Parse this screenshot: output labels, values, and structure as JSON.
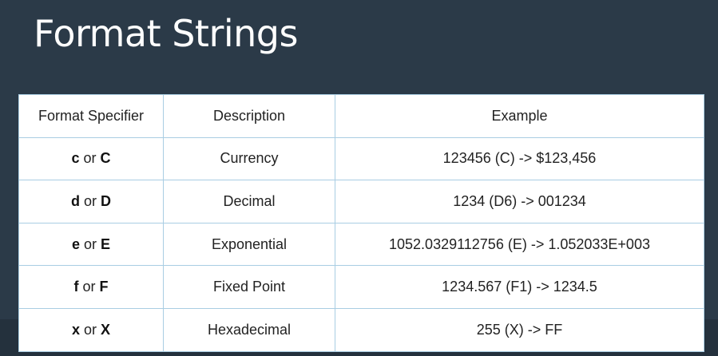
{
  "slide": {
    "title": "Format Strings"
  },
  "table": {
    "headers": [
      "Format Specifier",
      "Description",
      "Example"
    ],
    "rows": [
      {
        "lower": "c",
        "joiner": "or",
        "upper": "C",
        "description": "Currency",
        "example": "123456 (C) -> $123,456"
      },
      {
        "lower": "d",
        "joiner": "or",
        "upper": "D",
        "description": "Decimal",
        "example": "1234 (D6) -> 001234"
      },
      {
        "lower": "e",
        "joiner": "or",
        "upper": "E",
        "description": "Exponential",
        "example": "1052.0329112756 (E) -> 1.052033E+003"
      },
      {
        "lower": "f",
        "joiner": "or",
        "upper": "F",
        "description": "Fixed Point",
        "example": "1234.567 (F1) -> 1234.5"
      },
      {
        "lower": "x",
        "joiner": "or",
        "upper": "X",
        "description": "Hexadecimal",
        "example": "255 (X) -> FF"
      }
    ]
  }
}
